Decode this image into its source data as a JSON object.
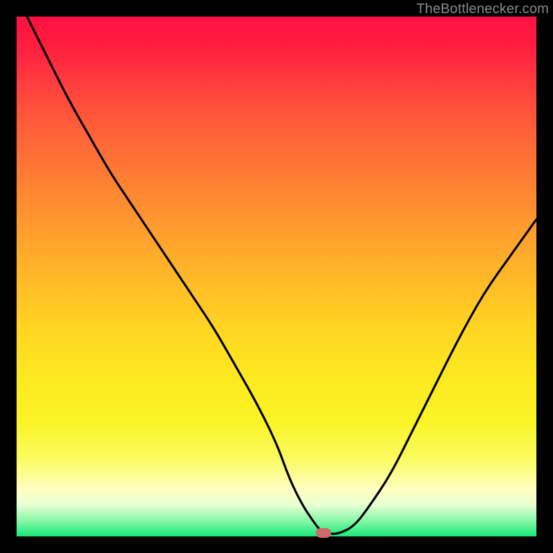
{
  "watermark": {
    "text": "TheBottlenecker.com"
  },
  "marker": {
    "color": "#cf6a6a"
  },
  "chart_data": {
    "type": "line",
    "title": "",
    "xlabel": "",
    "ylabel": "",
    "xlim": [
      0,
      100
    ],
    "ylim": [
      0,
      100
    ],
    "grid": false,
    "series": [
      {
        "name": "bottleneck-curve",
        "x": [
          2,
          6,
          10,
          14,
          18,
          22,
          26,
          30,
          34,
          38,
          42,
          46,
          50,
          52.5,
          55,
          57,
          58.5,
          60,
          62,
          65,
          68,
          72,
          76,
          80,
          85,
          90,
          95,
          100
        ],
        "y": [
          100,
          92,
          84,
          77,
          70,
          64,
          58,
          52,
          46,
          40,
          33,
          26,
          18,
          11,
          6,
          3,
          1,
          0.5,
          0.5,
          2,
          6,
          12,
          20,
          28,
          38,
          47,
          54,
          61
        ]
      }
    ],
    "marker_point": {
      "x": 59,
      "y": 0.6
    },
    "background_gradient": {
      "top": "#ff1041",
      "middle": "#ffd522",
      "bottom": "#19e878"
    }
  }
}
